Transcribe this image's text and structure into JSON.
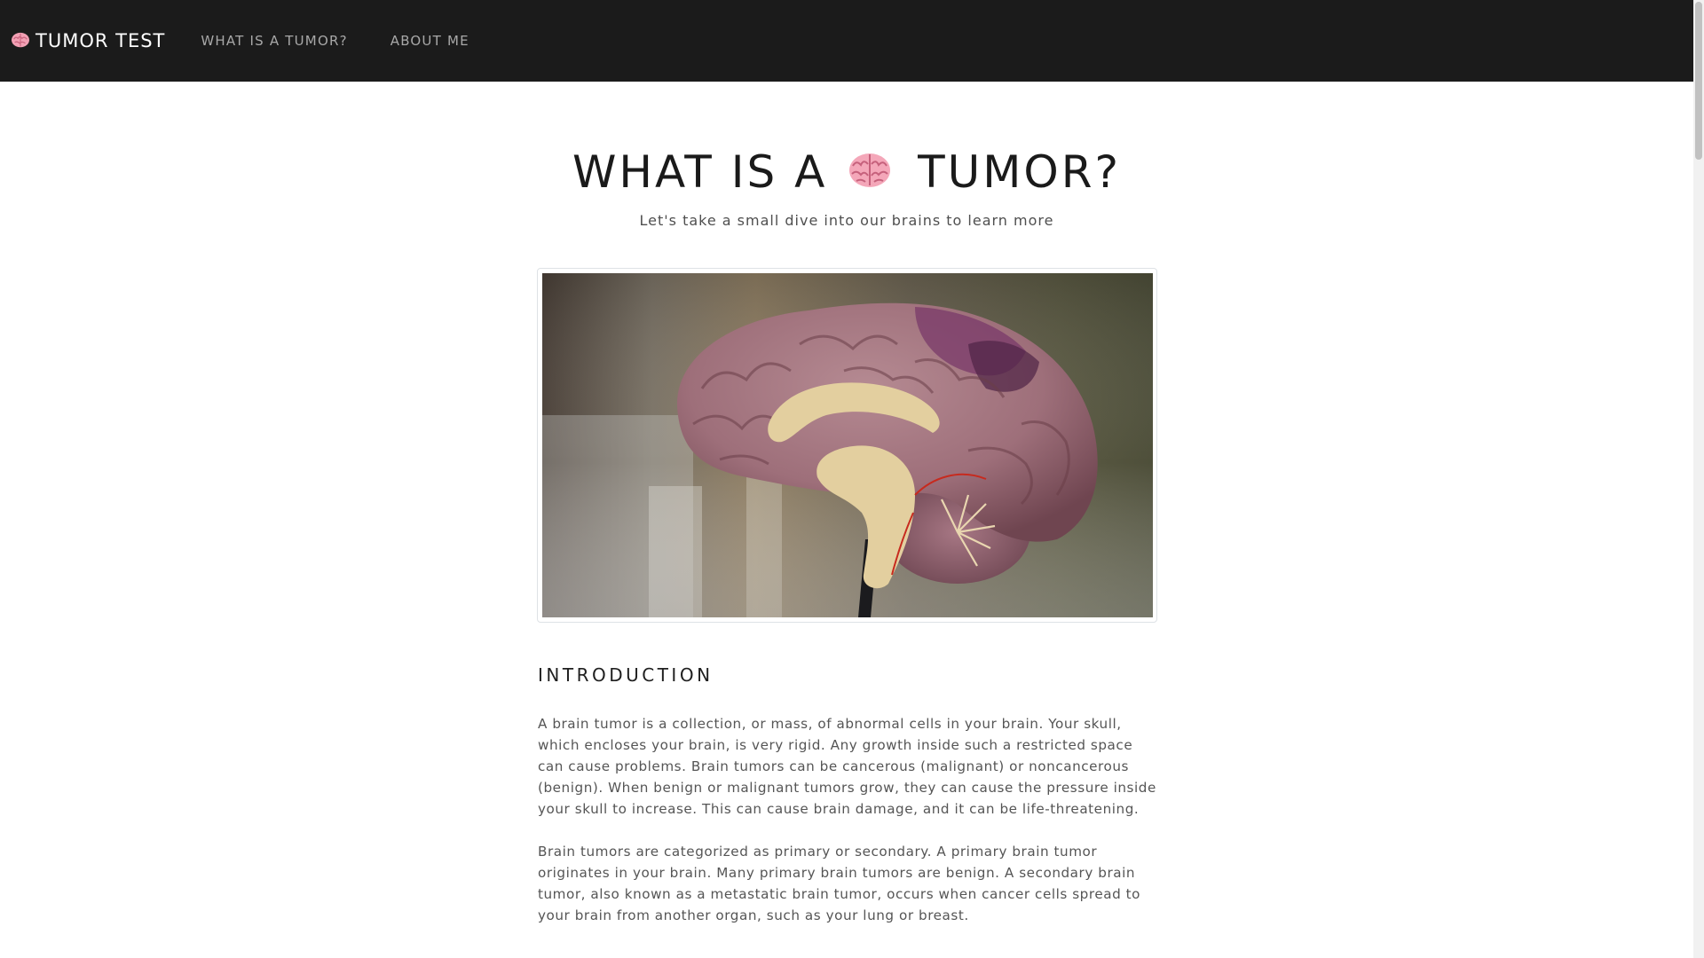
{
  "navbar": {
    "brand_icon": "brain-icon",
    "brand_text": "TUMOR TEST",
    "links": [
      {
        "label": "WHAT IS A TUMOR?"
      },
      {
        "label": "ABOUT ME"
      }
    ],
    "background": "#1b1b1b"
  },
  "hero": {
    "title_before": "WHAT IS A",
    "title_icon": "brain-icon",
    "title_after": "TUMOR?",
    "subtitle": "Let's take a small dive into our brains to learn more"
  },
  "image": {
    "subject": "brain-model-photo"
  },
  "introduction": {
    "heading": "INTRODUCTION",
    "paragraphs": [
      "A brain tumor is a collection, or mass, of abnormal cells in your brain. Your skull, which encloses your brain, is very rigid. Any growth inside such a restricted space can cause problems. Brain tumors can be cancerous (malignant) or noncancerous (benign). When benign or malignant tumors grow, they can cause the pressure inside your skull to increase. This can cause brain damage, and it can be life-threatening.",
      "Brain tumors are categorized as primary or secondary. A primary brain tumor originates in your brain. Many primary brain tumors are benign. A secondary brain tumor, also known as a metastatic brain tumor, occurs when cancer cells spread to your brain from another organ, such as your lung or breast."
    ]
  }
}
